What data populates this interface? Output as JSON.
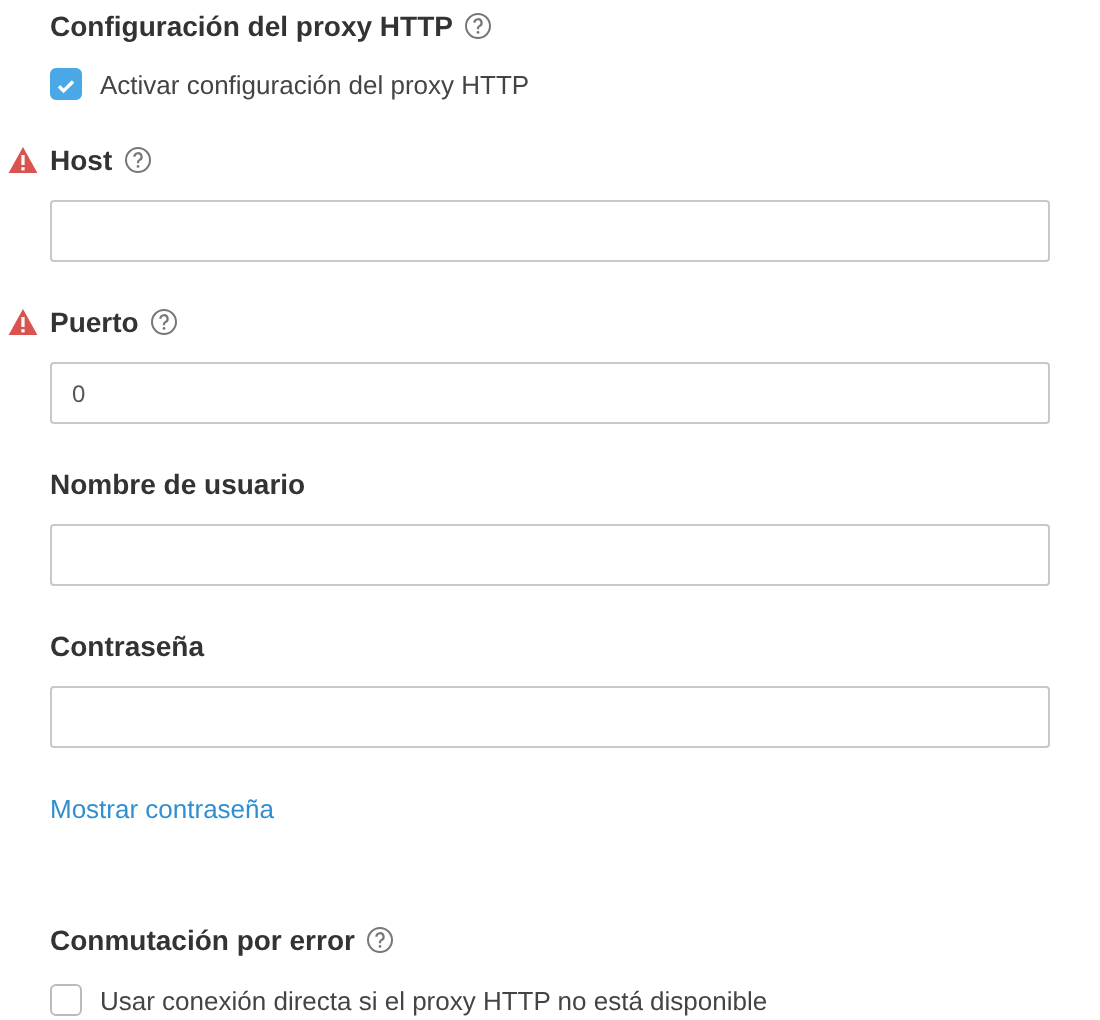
{
  "proxy_section": {
    "title": "Configuración del proxy HTTP",
    "help": true
  },
  "enable_checkbox": {
    "label": "Activar configuración del proxy HTTP",
    "checked": true
  },
  "fields": [
    {
      "label": "Host",
      "warning": true,
      "help": true
    },
    {
      "label": "Puerto",
      "warning": true,
      "help": true,
      "value": "0"
    },
    {
      "label": "Nombre de usuario",
      "warning": false,
      "help": false
    },
    {
      "label": "Contraseña",
      "warning": false,
      "help": false
    }
  ],
  "show_password_link": "Mostrar contraseña",
  "failover": {
    "title": "Conmutación por error",
    "help": true,
    "checkbox": {
      "label": "Usar conexión directa si el proxy HTTP no está disponible",
      "checked": false
    }
  }
}
